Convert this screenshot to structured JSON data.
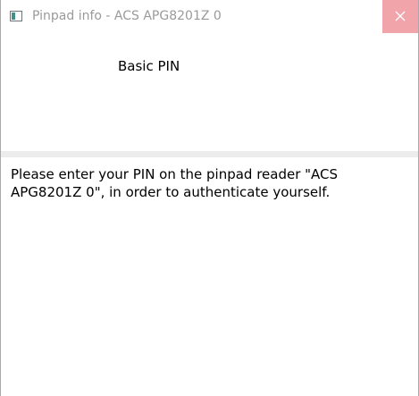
{
  "window": {
    "title": "Pinpad info - ACS APG8201Z 0",
    "icon": "window-app-icon",
    "close_icon": "close-icon",
    "close_hover_color": "#f1a5aa"
  },
  "header": {
    "title": "Basic PIN"
  },
  "message": {
    "text": "Please enter your PIN on the pinpad reader \"ACS APG8201Z 0\", in order to authenticate yourself."
  }
}
